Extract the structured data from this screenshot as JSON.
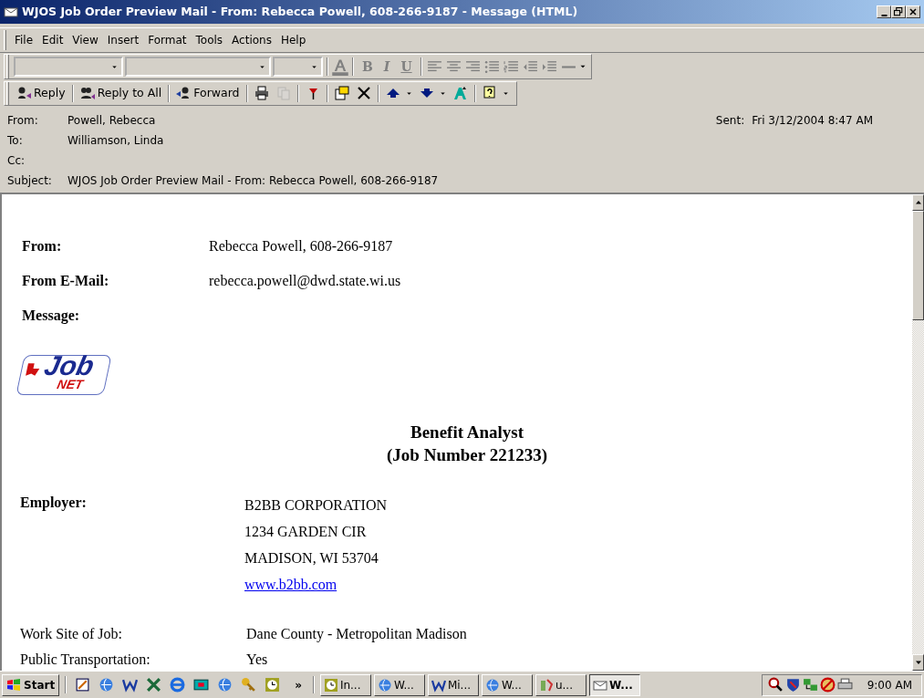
{
  "window": {
    "title": "WJOS Job Order Preview Mail - From: Rebecca Powell, 608-266-9187 - Message (HTML)"
  },
  "menu": [
    "File",
    "Edit",
    "View",
    "Insert",
    "Format",
    "Tools",
    "Actions",
    "Help"
  ],
  "format_toolbar": {
    "disabled": true,
    "style_buttons": [
      "B",
      "I",
      "U"
    ]
  },
  "standard_toolbar": [
    {
      "kind": "labeled",
      "label": "Reply",
      "disabled": false
    },
    {
      "kind": "labeled",
      "label": "Reply to All",
      "disabled": false
    },
    {
      "kind": "labeled",
      "label": "Forward",
      "disabled": false
    },
    {
      "kind": "icon",
      "disabled": false
    },
    {
      "kind": "icon",
      "disabled": true
    },
    {
      "kind": "icon",
      "disabled": false
    },
    {
      "kind": "icon",
      "disabled": false
    },
    {
      "kind": "icon",
      "disabled": false
    },
    {
      "kind": "dropdown",
      "disabled": false
    },
    {
      "kind": "dropdown",
      "disabled": false
    },
    {
      "kind": "icon",
      "disabled": false
    },
    {
      "kind": "dropdown",
      "disabled": false
    }
  ],
  "header": {
    "fields": [
      {
        "label": "From:",
        "value": "Powell, Rebecca"
      },
      {
        "label": "To:",
        "value": "Williamson, Linda"
      },
      {
        "label": "Cc:"
      },
      {
        "label": "Subject:",
        "value": "WJOS Job Order Preview Mail - From: Rebecca Powell, 608-266-9187"
      }
    ],
    "sent": {
      "label": "Sent:",
      "value": "Fri 3/12/2004 8:47 AM"
    }
  },
  "message": {
    "meta": [
      {
        "label": "From:",
        "value": "Rebecca Powell, 608-266-9187"
      },
      {
        "label": "From E-Mail:",
        "value": "rebecca.powell@dwd.state.wi.us"
      },
      {
        "label": "Message:"
      }
    ],
    "logo": {
      "text": "Job",
      "subtext": "NET"
    },
    "job_title": "Benefit Analyst",
    "job_number": "(Job Number 221233)",
    "employer": {
      "label": "Employer:",
      "lines": [
        "B2BB CORPORATION",
        "1234 GARDEN CIR",
        "MADISON, WI 53704"
      ],
      "website": "www.b2bb.com"
    },
    "details": [
      {
        "label": "Work Site of Job:",
        "value": "Dane County - Metropolitan Madison"
      },
      {
        "label": "Public Transportation:",
        "value": "Yes"
      }
    ]
  },
  "taskbar": {
    "start": "Start",
    "more": "»",
    "tasks": [
      {
        "label": "In...",
        "selected": false
      },
      {
        "label": "W...",
        "selected": false
      },
      {
        "label": "Mi...",
        "selected": false
      },
      {
        "label": "W...",
        "selected": false
      },
      {
        "label": "u...",
        "selected": false
      },
      {
        "label": "W...",
        "selected": true
      }
    ],
    "clock": "9:00 AM"
  }
}
